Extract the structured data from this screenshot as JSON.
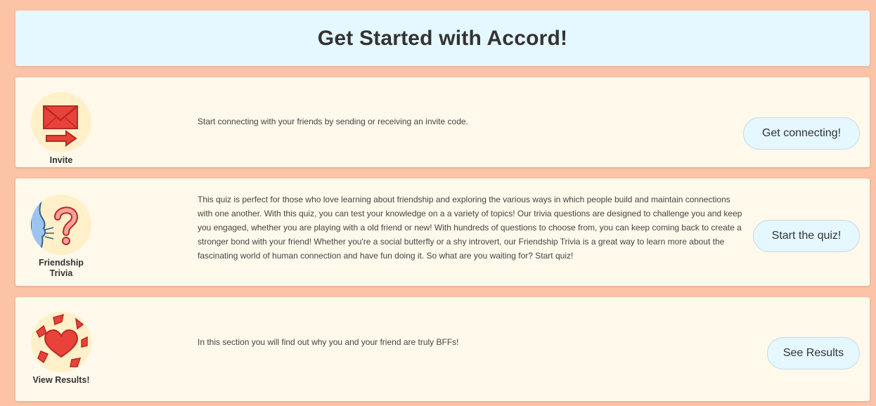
{
  "header": {
    "title": "Get Started with Accord!"
  },
  "sections": [
    {
      "label": "Invite",
      "icon": "envelope-arrow-icon",
      "description": "Start connecting with your friends by sending or receiving an invite code.",
      "button_label": "Get connecting!"
    },
    {
      "label": "Friendship Trivia",
      "icon": "face-question-icon",
      "description": "This quiz is perfect for those who love learning about friendship and exploring the various ways in which people build and maintain connections with one another. With this quiz, you can test your knowledge on a a variety of topics! Our trivia questions are designed to challenge you and keep you engaged, whether you are playing with a old friend or new! With hundreds of questions to choose from, you can keep coming back to create a stronger bond with your friend! Whether you're a social butterfly or a shy introvert, our Friendship Trivia is a great way to learn more about the fascinating world of human connection and have fun doing it. So what are you waiting for? Start quiz!",
      "button_label": "Start the quiz!"
    },
    {
      "label": "View Results!",
      "icon": "heart-burst-icon",
      "description": "In this section you will find out why you and your friend are truly BFFs!",
      "button_label": "See Results"
    }
  ],
  "colors": {
    "page_background": "#fdc3a6",
    "header_background": "#e5f7ff",
    "card_background": "#fff9eb",
    "icon_circle": "#fff0c9",
    "icon_red": "#e8423a",
    "button_background": "#e5f7ff"
  }
}
